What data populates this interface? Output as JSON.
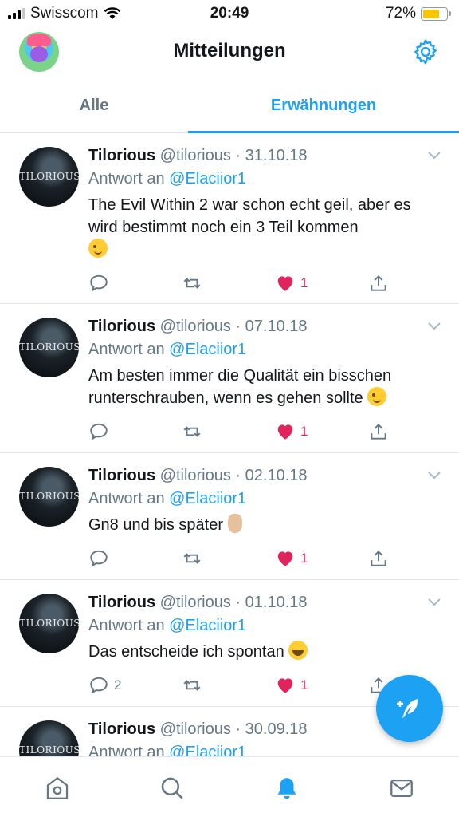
{
  "status": {
    "carrier": "Swisscom",
    "time": "20:49",
    "battery": "72%",
    "battery_level": 0.72
  },
  "header": {
    "title": "Mitteilungen"
  },
  "tabs": [
    {
      "label": "Alle"
    },
    {
      "label": "Erwähnungen",
      "active": true
    }
  ],
  "tweets": [
    {
      "name": "Tilorious",
      "meta": "@tilorious · 31.10.18",
      "reply_prefix": "Antwort an",
      "reply_handle": "@Elaciior1",
      "text": "The Evil Within 2 war schon echt geil, aber es wird bestimmt noch ein 3 Teil kommen",
      "emoji": "wink-icon",
      "replies": "",
      "likes": "1"
    },
    {
      "name": "Tilorious",
      "meta": "@tilorious · 07.10.18",
      "reply_prefix": "Antwort an",
      "reply_handle": "@Elaciior1",
      "text": "Am besten immer die Qualität ein bisschen runterschrauben, wenn es gehen sollte",
      "emoji": "wink-icon",
      "replies": "",
      "likes": "1"
    },
    {
      "name": "Tilorious",
      "meta": "@tilorious · 02.10.18",
      "reply_prefix": "Antwort an",
      "reply_handle": "@Elaciior1",
      "text": "Gn8 und bis später",
      "emoji": "peace-hand-icon",
      "replies": "",
      "likes": "1"
    },
    {
      "name": "Tilorious",
      "meta": "@tilorious · 01.10.18",
      "reply_prefix": "Antwort an",
      "reply_handle": "@Elaciior1",
      "text": "Das entscheide ich spontan",
      "emoji": "laughing-tears-icon",
      "replies": "2",
      "likes": "1"
    },
    {
      "name": "Tilorious",
      "meta": "@tilorious · 30.09.18",
      "reply_prefix": "Antwort an",
      "reply_handle": "@Elaciior1"
    }
  ],
  "avatar_logo": "TILORIOUS",
  "colors": {
    "accent": "#1da1f2",
    "like": "#e0245e",
    "muted": "#657786"
  },
  "icons": {
    "home": "home-icon",
    "search": "search-icon",
    "notifications": "bell-icon",
    "messages": "mail-icon",
    "compose": "compose-icon",
    "settings": "gear-icon"
  }
}
